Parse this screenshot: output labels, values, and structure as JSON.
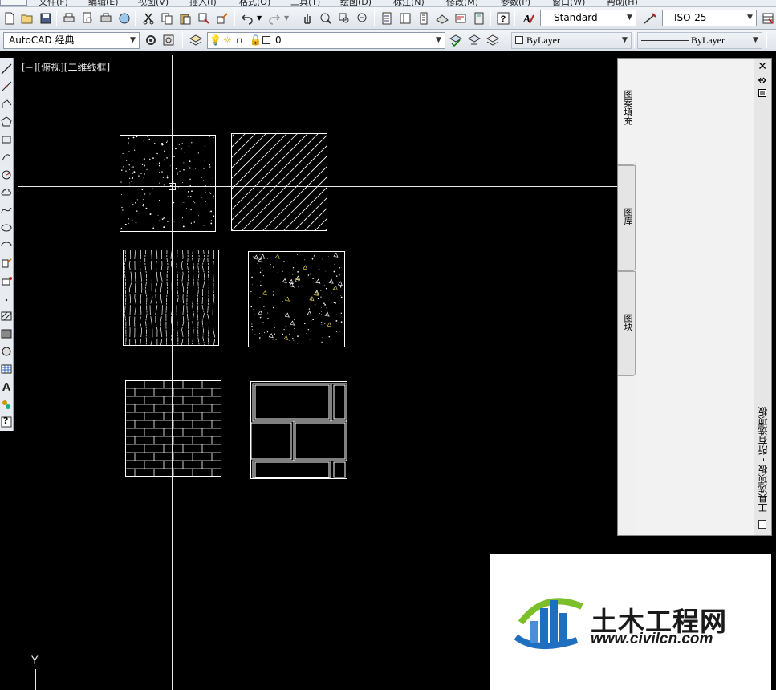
{
  "menubar": {
    "items": [
      "文件(F)",
      "编辑(E)",
      "视图(V)",
      "插入(I)",
      "格式(O)",
      "工具(T)",
      "绘图(D)",
      "标注(N)",
      "修改(M)",
      "参数(P)",
      "窗口(W)",
      "帮助(H)"
    ]
  },
  "toolbar1": {
    "text_style": "Standard",
    "dim_style": "ISO-25"
  },
  "toolbar2": {
    "workspace": "AutoCAD 经典",
    "layer": "0",
    "color": "ByLayer",
    "linetype": "ByLayer"
  },
  "viewport": {
    "label": "[−][俯视][二维线框]",
    "ucs_y": "Y"
  },
  "palette": {
    "tabs": [
      "图案填充",
      "图库",
      "图块"
    ],
    "title": "工具选项板 - 所有选项板",
    "close": "✕"
  },
  "left_toolbar": {
    "text_tool": "A",
    "help": "?"
  },
  "watermark": {
    "cn": "土木工程网",
    "url": "www.civilcn.com"
  },
  "colors": {
    "canvas": "#000000",
    "crosshair": "#e8e8e8",
    "hatch": "#ffffff",
    "accent_hatch": "#d9c94a",
    "logo_blue": "#1f6fc0",
    "logo_green": "#7bbf2a"
  }
}
